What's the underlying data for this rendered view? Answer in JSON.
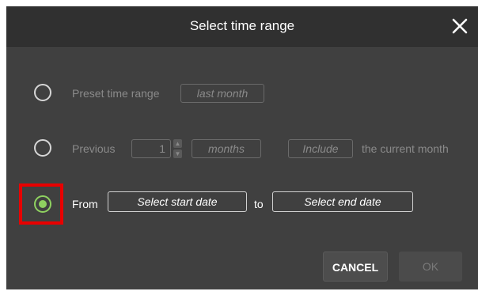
{
  "dialog": {
    "title": "Select time range",
    "close_icon": "close-icon"
  },
  "options": {
    "preset": {
      "label": "Preset time range",
      "value": "last month"
    },
    "previous": {
      "label": "Previous",
      "count": "1",
      "unit": "months",
      "include_label": "Include",
      "suffix": "the current month"
    },
    "from_to": {
      "from_label": "From",
      "start_placeholder": "Select start date",
      "to_label": "to",
      "end_placeholder": "Select end date",
      "selected": true
    }
  },
  "buttons": {
    "cancel": "CANCEL",
    "ok": "OK"
  },
  "colors": {
    "accent": "#8fd160",
    "highlight": "#e80000",
    "background": "#404040",
    "titlebar": "#303030"
  }
}
